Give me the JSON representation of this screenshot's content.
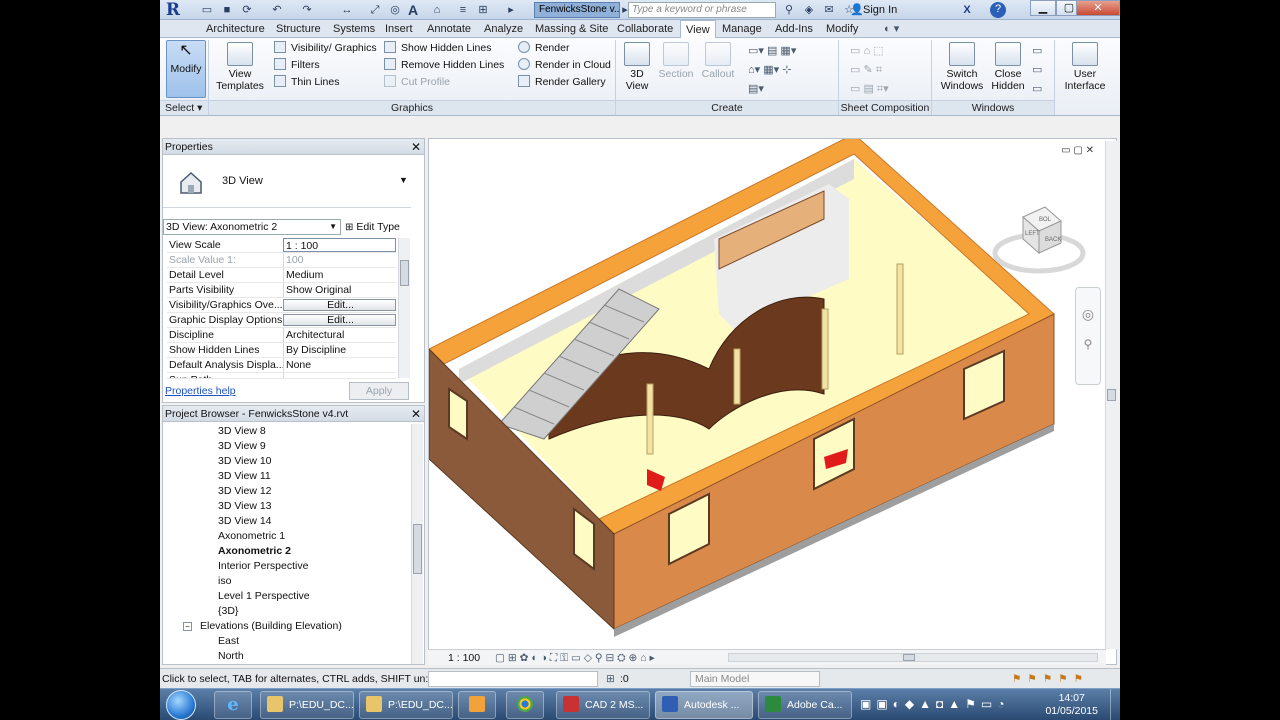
{
  "titlebar": {
    "doc_tab": "FenwicksStone v...",
    "search_placeholder": "Type a keyword or phrase",
    "signin": "Sign In",
    "help": "?"
  },
  "ribbon_tabs": [
    "Architecture",
    "Structure",
    "Systems",
    "Insert",
    "Annotate",
    "Analyze",
    "Massing & Site",
    "Collaborate",
    "View",
    "Manage",
    "Add-Ins",
    "Modify"
  ],
  "active_tab": "View",
  "ribbon": {
    "modify": "Modify",
    "select": "Select",
    "view_templates": "View Templates",
    "graphics_items": [
      "Visibility/ Graphics",
      "Filters",
      "Thin Lines"
    ],
    "hidden_items": [
      "Show Hidden Lines",
      "Remove Hidden Lines",
      "Cut Profile"
    ],
    "render_items": [
      "Render",
      "Render in Cloud",
      "Render Gallery"
    ],
    "graphics_label": "Graphics",
    "create_btns": [
      "3D View",
      "Section",
      "Callout"
    ],
    "create_label": "Create",
    "sheet_label": "Sheet Composition",
    "switch_windows": "Switch Windows",
    "close_hidden": "Close Hidden",
    "user_interface": "User Interface",
    "windows_label": "Windows"
  },
  "properties": {
    "title": "Properties",
    "type_name": "3D View",
    "view_select": "3D View: Axonometric 2",
    "edit_type": "Edit Type",
    "rows": [
      {
        "name": "View Scale",
        "value": "1 : 100"
      },
      {
        "name": "Scale Value   1:",
        "value": "100"
      },
      {
        "name": "Detail Level",
        "value": "Medium"
      },
      {
        "name": "Parts Visibility",
        "value": "Show Original"
      },
      {
        "name": "Visibility/Graphics Ove...",
        "value": "Edit..."
      },
      {
        "name": "Graphic Display Options",
        "value": "Edit..."
      },
      {
        "name": "Discipline",
        "value": "Architectural"
      },
      {
        "name": "Show Hidden Lines",
        "value": "By Discipline"
      },
      {
        "name": "Default Analysis Displa...",
        "value": "None"
      },
      {
        "name": "Sun Path",
        "value": ""
      }
    ],
    "help": "Properties help",
    "apply": "Apply"
  },
  "browser": {
    "title": "Project Browser - FenwicksStone v4.rvt",
    "items": [
      "3D View 8",
      "3D View 9",
      "3D View 10",
      "3D View 11",
      "3D View 12",
      "3D View 13",
      "3D View 14",
      "Axonometric 1",
      "Axonometric 2",
      "Interior Perspective",
      "iso",
      "Level 1 Perspective",
      "{3D}"
    ],
    "selected": "Axonometric 2",
    "elevations_group": "Elevations (Building Elevation)",
    "elevations": [
      "East",
      "North"
    ]
  },
  "viewport": {
    "scale": "1 : 100",
    "viewcube_faces": [
      "BOL",
      "BACK",
      "LEFT"
    ]
  },
  "status": {
    "hint": "Click to select, TAB for alternates, CTRL adds, SHIFT un:",
    "zero": ":0",
    "model": "Main Model"
  },
  "taskbar": {
    "tasks": [
      {
        "label": "P:\\EDU_DC...",
        "color": "#e8c56a"
      },
      {
        "label": "P:\\EDU_DC...",
        "color": "#e8c56a"
      },
      {
        "label": "",
        "color": "#f2a23a"
      },
      {
        "label": "",
        "color": "#4aa84a"
      },
      {
        "label": "CAD 2 MS...",
        "color": "#c83232"
      },
      {
        "label": "Autodesk ...",
        "color": "#2f5fb5"
      },
      {
        "label": "Adobe Ca...",
        "color": "#2b8a3e"
      }
    ],
    "time": "14:07",
    "date": "01/05/2015"
  }
}
